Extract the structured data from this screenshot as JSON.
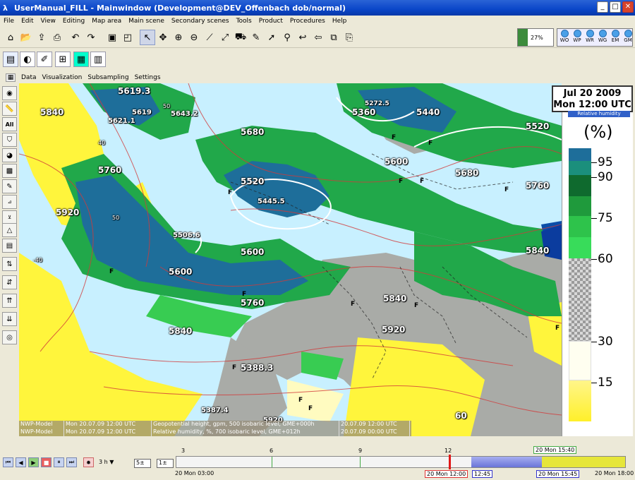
{
  "window": {
    "title": "UserManual_FILL - Mainwindow (Development@DEV_Offenbach dob/normal)"
  },
  "menubar": [
    "File",
    "Edit",
    "View",
    "Editing",
    "Map area",
    "Main scene",
    "Secondary scenes",
    "Tools",
    "Product",
    "Procedures",
    "Help"
  ],
  "toolbar": {
    "progress_label": "27%",
    "progress_fraction": 0.27
  },
  "status_lights": [
    "WO",
    "WP",
    "WR",
    "WG",
    "EM",
    "GM"
  ],
  "submenu": [
    "Data",
    "Visualization",
    "Subsampling",
    "Settings"
  ],
  "map": {
    "date_line1": "Jul 20 2009",
    "date_line2": "Mon 12:00 UTC",
    "contour_labels": [
      "5619.3",
      "5840",
      "5619",
      "5643.2",
      "5621.1",
      "5360",
      "5272.5",
      "5440",
      "5680",
      "5520",
      "5760",
      "5600",
      "5680",
      "5520",
      "5445.5",
      "5920",
      "5506.6",
      "5600",
      "5600",
      "5760",
      "5840",
      "5760",
      "5840",
      "5840",
      "5920",
      "5388.3",
      "5387.4",
      "5920",
      "60",
      "50",
      "40",
      "-40",
      "50"
    ]
  },
  "info_panel": {
    "row1": [
      "NWP-Model",
      "Mon 20.07.09 12:00 UTC",
      "Geopotential height, gpm, 500 isobaric level, GME+000h",
      "20.07.09 12:00 UTC"
    ],
    "row2": [
      "NWP-Model",
      "Mon 20.07.09 12:00 UTC",
      "Relative humidity, %, 700 isobaric level, GME+012h",
      "20.07.09 00:00 UTC"
    ]
  },
  "legend": {
    "title": "Relative humidity",
    "unit": "(%)",
    "labels": [
      "95",
      "90",
      "75",
      "60",
      "30",
      "15"
    ]
  },
  "timeline": {
    "interval": "3 h",
    "step1": "5",
    "step2": "1",
    "tick_labels": [
      "3",
      "6",
      "9",
      "12"
    ],
    "top_right_label": "20 Mon 15:40",
    "bottom_labels": [
      "20 Mon 03:00",
      "20 Mon 12:00",
      "12:45",
      "20 Mon 15:45",
      "20 Mon 18:00"
    ]
  },
  "colors": {
    "humid_dark": "#1e6e9a",
    "humid_mid": "#21a84a",
    "humid_light": "#38cc52",
    "dry": "#fff53c",
    "land": "#a9aba7",
    "sea": "#c8f0ff"
  }
}
